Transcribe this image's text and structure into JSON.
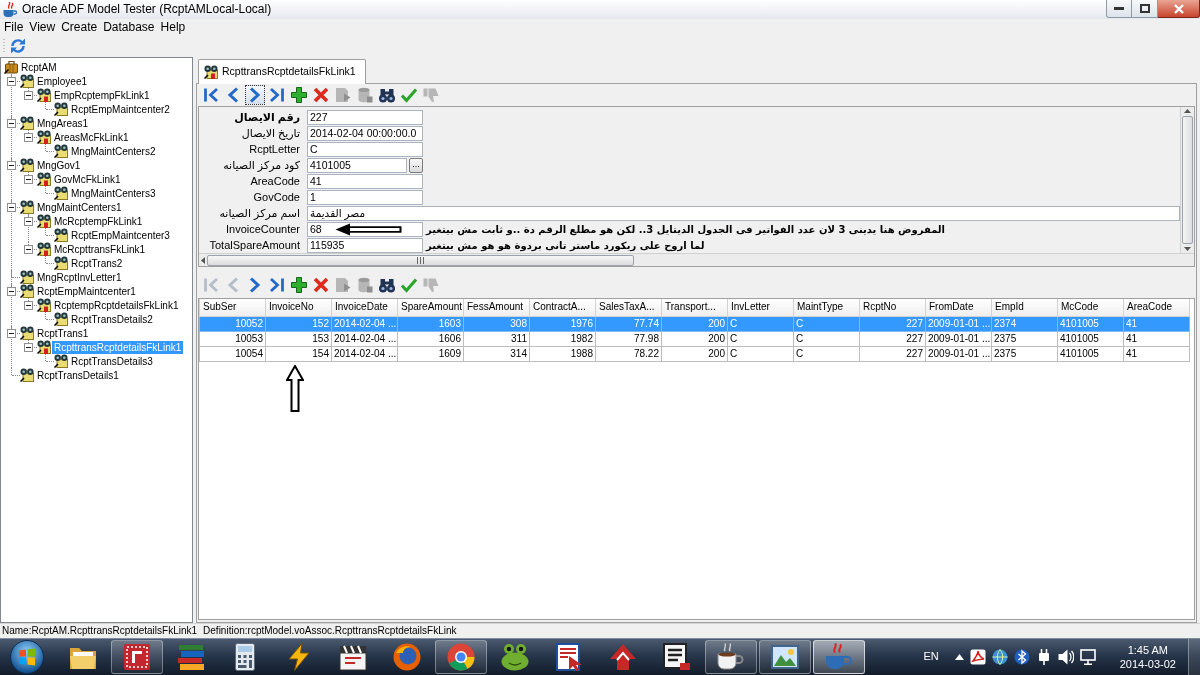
{
  "window": {
    "title": "Oracle ADF Model Tester (RcptAMLocal-Local)"
  },
  "menu": [
    "File",
    "View",
    "Create",
    "Database",
    "Help"
  ],
  "tree": {
    "items": [
      {
        "label": "RcptAM",
        "kind": "module",
        "selected": false,
        "children": [
          {
            "label": "Employee1",
            "kind": "view",
            "expanded": true,
            "selected": false,
            "children": [
              {
                "label": "EmpRcptempFkLink1",
                "kind": "link",
                "expanded": true,
                "selected": false,
                "children": [
                  {
                    "label": "RcptEmpMaintcenter2",
                    "kind": "view",
                    "expanded": false,
                    "selected": false
                  }
                ]
              }
            ]
          },
          {
            "label": "MngAreas1",
            "kind": "view",
            "expanded": true,
            "selected": false,
            "children": [
              {
                "label": "AreasMcFkLink1",
                "kind": "link",
                "expanded": true,
                "selected": false,
                "children": [
                  {
                    "label": "MngMaintCenters2",
                    "kind": "view",
                    "expanded": false,
                    "selected": false
                  }
                ]
              }
            ]
          },
          {
            "label": "MngGov1",
            "kind": "view",
            "expanded": true,
            "selected": false,
            "children": [
              {
                "label": "GovMcFkLink1",
                "kind": "link",
                "expanded": true,
                "selected": false,
                "children": [
                  {
                    "label": "MngMaintCenters3",
                    "kind": "view",
                    "expanded": false,
                    "selected": false
                  }
                ]
              }
            ]
          },
          {
            "label": "MngMaintCenters1",
            "kind": "view",
            "expanded": true,
            "selected": false,
            "children": [
              {
                "label": "McRcptempFkLink1",
                "kind": "link",
                "expanded": true,
                "selected": false,
                "children": [
                  {
                    "label": "RcptEmpMaintcenter3",
                    "kind": "view",
                    "expanded": false,
                    "selected": false
                  }
                ]
              },
              {
                "label": "McRcpttransFkLink1",
                "kind": "link",
                "expanded": true,
                "selected": false,
                "children": [
                  {
                    "label": "RcptTrans2",
                    "kind": "view",
                    "expanded": false,
                    "selected": false
                  }
                ]
              }
            ]
          },
          {
            "label": "MngRcptInvLetter1",
            "kind": "view",
            "expanded": false,
            "selected": false
          },
          {
            "label": "RcptEmpMaintcenter1",
            "kind": "view",
            "expanded": true,
            "selected": false,
            "children": [
              {
                "label": "RcptempRcptdetailsFkLink1",
                "kind": "link",
                "expanded": true,
                "selected": false,
                "children": [
                  {
                    "label": "RcptTransDetails2",
                    "kind": "view",
                    "expanded": false,
                    "selected": false
                  }
                ]
              }
            ]
          },
          {
            "label": "RcptTrans1",
            "kind": "view",
            "expanded": true,
            "selected": false,
            "children": [
              {
                "label": "RcpttransRcptdetailsFkLink1",
                "kind": "link",
                "expanded": true,
                "selected": true,
                "children": [
                  {
                    "label": "RcptTransDetails3",
                    "kind": "view",
                    "expanded": false,
                    "selected": false
                  }
                ]
              }
            ]
          },
          {
            "label": "RcptTransDetails1",
            "kind": "view",
            "expanded": false,
            "selected": false
          }
        ]
      }
    ]
  },
  "tabs": [
    {
      "label": "RcpttransRcptdetailsFkLink1",
      "selected": true
    }
  ],
  "form_toolbar": [
    {
      "kind": "first",
      "enabled": true,
      "focused": false
    },
    {
      "kind": "previous",
      "enabled": true,
      "focused": false
    },
    {
      "kind": "next",
      "enabled": true,
      "focused": true
    },
    {
      "kind": "last",
      "enabled": true,
      "focused": false
    },
    {
      "kind": "add",
      "enabled": true,
      "focused": false
    },
    {
      "kind": "delete",
      "enabled": true,
      "focused": false
    },
    {
      "kind": "document",
      "enabled": false,
      "focused": false
    },
    {
      "kind": "database",
      "enabled": false,
      "focused": false
    },
    {
      "kind": "find",
      "enabled": true,
      "focused": false
    },
    {
      "kind": "check",
      "enabled": true
    },
    {
      "kind": "thumbs_down",
      "enabled": false,
      "focused": false
    }
  ],
  "form": {
    "fields": [
      {
        "label": "رقم الايصال",
        "key": true,
        "kind": "text",
        "value": "227",
        "arrow": false
      },
      {
        "label": "تاريخ الايصال",
        "key": false,
        "kind": "text",
        "value": "2014-02-04 00:00:00.0",
        "arrow": false
      },
      {
        "label": "RcptLetter",
        "key": false,
        "kind": "text",
        "value": "C",
        "arrow": false
      },
      {
        "label": "كود مركز الصيانه",
        "key": false,
        "kind": "lookup",
        "value": "4101005",
        "button": "...",
        "arrow": false
      },
      {
        "label": "AreaCode",
        "key": false,
        "kind": "text",
        "value": "41",
        "arrow": false
      },
      {
        "label": "GovCode",
        "key": false,
        "kind": "text",
        "value": "1",
        "arrow": false
      },
      {
        "label": "اسم مركز الصيانه",
        "key": false,
        "kind": "wide",
        "value": "مصر القديمة",
        "arrow": false
      },
      {
        "label": "InvoiceCounter",
        "key": false,
        "kind": "text",
        "value": "68",
        "arrow": true,
        "note": "المفروض هنا يدينى 3 لان عدد الفواتير فى الجدول الديتايل 3.. لكن هو مطلع الرقم دة ..و ثابت مش بيتغير"
      },
      {
        "label": "TotalSpareAmount",
        "key": false,
        "kind": "text",
        "value": "115935",
        "arrow": false,
        "note": "لما اروح على ريكورد  ماستر تانى بردوة هو هو مش بيتغير"
      }
    ]
  },
  "table_toolbar": [
    {
      "kind": "first",
      "enabled": false
    },
    {
      "kind": "previous",
      "enabled": false
    },
    {
      "kind": "next",
      "enabled": true
    },
    {
      "kind": "last",
      "enabled": true
    },
    {
      "kind": "add",
      "enabled": true
    },
    {
      "kind": "delete",
      "enabled": true
    },
    {
      "kind": "document",
      "enabled": false
    },
    {
      "kind": "database",
      "enabled": false
    },
    {
      "kind": "find",
      "enabled": true
    },
    {
      "kind": "check",
      "enabled": true
    },
    {
      "kind": "thumbs_down",
      "enabled": false
    }
  ],
  "table": {
    "columns": [
      {
        "label": "SubSer",
        "kind": "number"
      },
      {
        "label": "InvoiceNo",
        "kind": "number"
      },
      {
        "label": "InvoiceDate",
        "kind": "text"
      },
      {
        "label": "SpareAmount",
        "kind": "number"
      },
      {
        "label": "FessAmount",
        "kind": "number"
      },
      {
        "label": "ContractA...",
        "kind": "number"
      },
      {
        "label": "SalesTaxA...",
        "kind": "number"
      },
      {
        "label": "Transport...",
        "kind": "number"
      },
      {
        "label": "InvLetter",
        "kind": "text"
      },
      {
        "label": "MaintType",
        "kind": "text"
      },
      {
        "label": "RcptNo",
        "kind": "number"
      },
      {
        "label": "FromDate",
        "kind": "text"
      },
      {
        "label": "EmpId",
        "kind": "text"
      },
      {
        "label": "McCode",
        "kind": "text"
      },
      {
        "label": "AreaCode",
        "kind": "text"
      }
    ],
    "rows": [
      {
        "selected": true,
        "cells": [
          "10052",
          "152",
          "2014-02-04 ...",
          "1603",
          "308",
          "1976",
          "77.74",
          "200",
          "C",
          "C",
          "227",
          "2009-01-01 ...",
          "2374",
          "4101005",
          "41"
        ]
      },
      {
        "selected": false,
        "cells": [
          "10053",
          "153",
          "2014-02-04 ...",
          "1606",
          "311",
          "1982",
          "77.98",
          "200",
          "C",
          "C",
          "227",
          "2009-01-01 ...",
          "2375",
          "4101005",
          "41"
        ]
      },
      {
        "selected": false,
        "cells": [
          "10054",
          "154",
          "2014-02-04 ...",
          "1609",
          "314",
          "1988",
          "78.22",
          "200",
          "C",
          "C",
          "227",
          "2009-01-01 ...",
          "2375",
          "4101005",
          "41"
        ]
      }
    ]
  },
  "status_bar": {
    "name": "Name:RcptAM.RcpttransRcptdetailsFkLink1",
    "definition": "Definition:rcptModel.voAssoc.RcpttransRcptdetailsFkLink"
  },
  "taskbar": {
    "apps": [
      {
        "kind": "folder",
        "running": false,
        "active": false
      },
      {
        "kind": "tile",
        "running": true,
        "active": false
      },
      {
        "kind": "books",
        "running": false,
        "active": false
      },
      {
        "kind": "calculator",
        "running": false,
        "active": false
      },
      {
        "kind": "lightning",
        "running": false,
        "active": false
      },
      {
        "kind": "clapperboard",
        "running": false,
        "active": false
      },
      {
        "kind": "globe",
        "running": false,
        "active": false
      },
      {
        "kind": "segmented_circle",
        "running": true,
        "active": false
      },
      {
        "kind": "frog",
        "running": false,
        "active": false
      },
      {
        "kind": "document_pointer",
        "running": false,
        "active": false
      },
      {
        "kind": "arrow_logo",
        "running": false,
        "active": false
      },
      {
        "kind": "document_stack",
        "running": false,
        "active": false
      },
      {
        "kind": "coffee_cup",
        "running": true,
        "active": false
      },
      {
        "kind": "picture",
        "running": true,
        "active": false
      },
      {
        "kind": "steaming_cup",
        "running": true,
        "active": true
      }
    ],
    "language": "EN",
    "time": "1:45 AM",
    "date": "2014-03-02"
  }
}
